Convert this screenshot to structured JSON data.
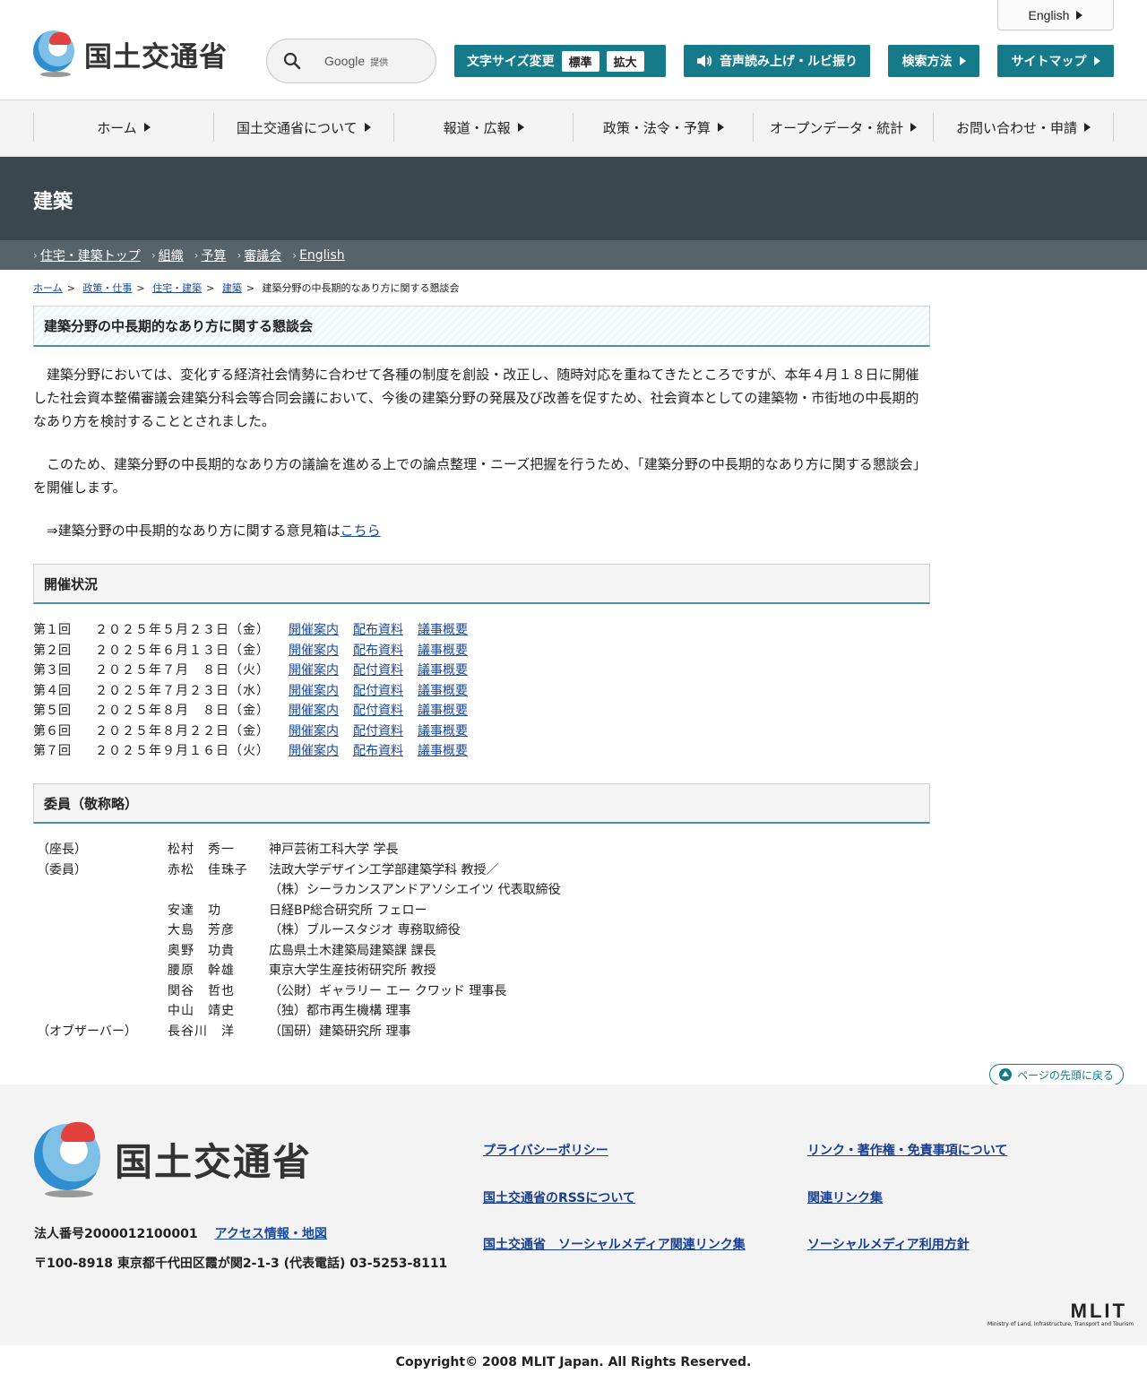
{
  "header": {
    "logo_text": "国土交通省",
    "search": {
      "provider": "Google",
      "provided": "提供"
    },
    "fontsize": {
      "label": "文字サイズ変更",
      "standard": "標準",
      "large": "拡大"
    },
    "voice_label": "音声読み上げ・ルビ振り",
    "search_method_label": "検索方法",
    "sitemap_label": "サイトマップ",
    "english_label": "English"
  },
  "gnav": {
    "items": [
      {
        "label": "ホーム"
      },
      {
        "label": "国土交通省について"
      },
      {
        "label": "報道・広報"
      },
      {
        "label": "政策・法令・予算"
      },
      {
        "label": "オープンデータ・統計"
      },
      {
        "label": "お問い合わせ・申請"
      }
    ]
  },
  "section": {
    "title": "建築",
    "subnav": [
      "住宅・建築トップ",
      "組織",
      "予算",
      "審議会",
      "English"
    ]
  },
  "breadcrumb": [
    "ホーム",
    "政策・仕事",
    "住宅・建築",
    "建築",
    "建築分野の中長期的なあり方に関する懇談会"
  ],
  "main": {
    "title": "建築分野の中長期的なあり方に関する懇談会",
    "p1": "建築分野においては、変化する経済社会情勢に合わせて各種の制度を創設・改正し、随時対応を重ねてきたところですが、本年４月１８日に開催した社会資本整備審議会建築分科会等合同会議において、今後の建築分野の発展及び改善を促すため、社会資本としての建築物・市街地の中長期的なあり方を検討することとされました。",
    "p2": "このため、建築分野の中長期的なあり方の議論を進める上での論点整理・ニーズ把握を行うため、「建築分野の中長期的なあり方に関する懇談会」を開催します。",
    "p3_text": "⇒建築分野の中長期的なあり方に関する意見箱は",
    "p3_link": "こちら",
    "status_heading": "開催状況",
    "sessions": [
      {
        "num": "第１回",
        "date": "２０２５年５月２３日（金）",
        "l1": "開催案内",
        "l2": "配布資料",
        "l3": "議事概要"
      },
      {
        "num": "第２回",
        "date": "２０２５年６月１３日（金）",
        "l1": "開催案内",
        "l2": "配布資料",
        "l3": "議事概要"
      },
      {
        "num": "第３回",
        "date": "２０２５年７月　８日（火）",
        "l1": "開催案内",
        "l2": "配付資料",
        "l3": "議事概要"
      },
      {
        "num": "第４回",
        "date": "２０２５年７月２３日（水）",
        "l1": "開催案内",
        "l2": "配付資料",
        "l3": "議事概要"
      },
      {
        "num": "第５回",
        "date": "２０２５年８月　８日（金）",
        "l1": "開催案内",
        "l2": "配付資料",
        "l3": "議事概要"
      },
      {
        "num": "第６回",
        "date": "２０２５年８月２２日（金）",
        "l1": "開催案内",
        "l2": "配付資料",
        "l3": "議事概要"
      },
      {
        "num": "第７回",
        "date": "２０２５年９月１６日（火）",
        "l1": "開催案内",
        "l2": "配布資料",
        "l3": "議事概要"
      }
    ],
    "members_heading": "委員（敬称略）",
    "members": [
      {
        "role": "（座長）",
        "name": "松村　秀一",
        "aff": "神戸芸術工科大学 学長"
      },
      {
        "role": "（委員）",
        "name": "赤松　佳珠子",
        "aff": "法政大学デザイン工学部建築学科 教授／"
      },
      {
        "role": "",
        "name": "",
        "aff": "（株）シーラカンスアンドアソシエイツ 代表取締役"
      },
      {
        "role": "",
        "name": "安達　功",
        "aff": "日経BP総合研究所 フェロー"
      },
      {
        "role": "",
        "name": "大島　芳彦",
        "aff": "（株）ブルースタジオ 専務取締役"
      },
      {
        "role": "",
        "name": "奥野　功貴",
        "aff": "広島県土木建築局建築課 課長"
      },
      {
        "role": "",
        "name": "腰原　幹雄",
        "aff": "東京大学生産技術研究所 教授"
      },
      {
        "role": "",
        "name": "関谷　哲也",
        "aff": "（公財）ギャラリー エー クワッド 理事長"
      },
      {
        "role": "",
        "name": "中山　靖史",
        "aff": "（独）都市再生機構 理事"
      },
      {
        "role": "（オブザーバー）",
        "name": "長谷川　洋",
        "aff": "（国研）建築研究所 理事"
      }
    ]
  },
  "pagetop_label": "ページの先頭に戻る",
  "footer": {
    "logo_text": "国土交通省",
    "corp_number": "法人番号2000012100001",
    "access_link": "アクセス情報・地図",
    "address": "〒100-8918 東京都千代田区霞が関2-1-3 (代表電話) 03-5253-8111",
    "links": [
      "プライバシーポリシー",
      "国土交通省のRSSについて",
      "国土交通省　ソーシャルメディア関連リンク集",
      "リンク・著作権・免責事項について",
      "関連リンク集",
      "ソーシャルメディア利用方針"
    ],
    "mlit_big": "MLIT",
    "mlit_small": "Ministry of Land, Infrastructure, Transport and Tourism",
    "copyright": "Copyright© 2008 MLIT Japan. All Rights Reserved."
  },
  "colors": {
    "teal": "#157b8a",
    "band": "#3b474e",
    "subnav": "#56636a",
    "link": "#1a4a9e"
  }
}
